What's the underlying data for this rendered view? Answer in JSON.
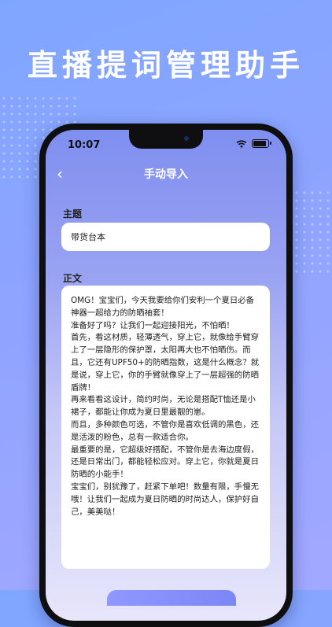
{
  "headline": "直播提词管理助手",
  "status": {
    "time": "10:07"
  },
  "nav": {
    "title": "手动导入"
  },
  "form": {
    "subject_label": "主题",
    "subject_value": "带货台本",
    "body_label": "正文",
    "body_text": "OMG！宝宝们，今天我要给你们安利一个夏日必备神器一超给力的防晒袖套！\n准备好了吗？让我们一起迎接阳光，不怕晒！\n首先，看这材质，轻薄透气，穿上它，就像给手臂穿上了一层隐形的保护罩，太阳再大也不怕晒伤。而且，它还有UPF50+的防晒指数，这是什么概念？就是说，穿上它，你的手臂就像穿上了一层超强的防晒盾牌！\n再来看看这设计，简约时尚，无论是搭配T恤还是小裙子，都能让你成为夏日里最靓的崽。\n而且，多种颜色可选，不管你是喜欢低调的黑色，还是活泼的粉色，总有一款适合你。\n最重要的是，它超级好搭配，不管你是去海边度假，还是日常出门，都能轻松应对。穿上它，你就是夏日防晒的小能手！\n宝宝们，别犹豫了，赶紧下单吧！数量有限，手慢无哦！让我们一起成为夏日防晒的时尚达人，保护好自己，美美哒！"
  },
  "icons": {
    "back": "chevron-left-icon",
    "wifi": "wifi-icon",
    "battery": "battery-icon"
  }
}
